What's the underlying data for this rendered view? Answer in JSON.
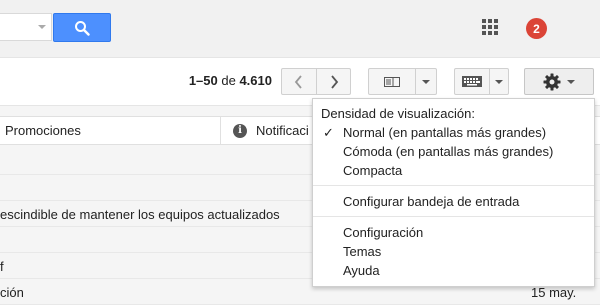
{
  "header": {
    "notification_count": "2"
  },
  "toolbar": {
    "range": "1–50",
    "of_label": "de",
    "total": "4.610"
  },
  "tabs": {
    "promotions": "Promociones",
    "notifications": "Notificaci"
  },
  "rows": [
    {
      "text": "",
      "date": ""
    },
    {
      "text": "",
      "date": ""
    },
    {
      "text": "escindible de mantener los equipos actualizados",
      "date": ""
    },
    {
      "text": "",
      "date": ""
    },
    {
      "text": "f",
      "date": ""
    },
    {
      "text": "ción",
      "date": "15 may."
    }
  ],
  "settings_menu": {
    "density_heading": "Densidad de visualización:",
    "density_normal": "Normal (en pantallas más grandes)",
    "density_comfortable": "Cómoda (en pantallas más grandes)",
    "density_compact": "Compacta",
    "configure_inbox": "Configurar bandeja de entrada",
    "settings": "Configuración",
    "themes": "Temas",
    "help": "Ayuda",
    "checkmark": "✓"
  },
  "colors": {
    "search_button": "#4d90fe",
    "badge": "#db4437"
  }
}
